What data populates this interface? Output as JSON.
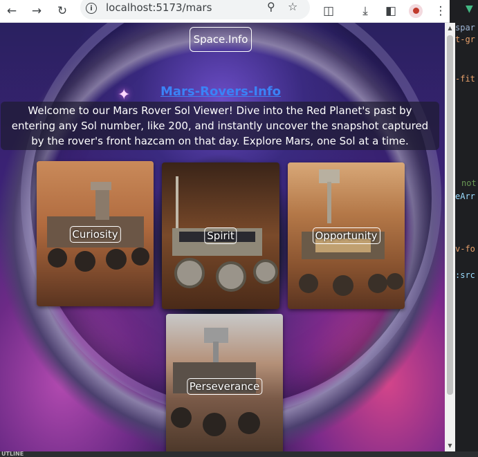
{
  "browser": {
    "url": "localhost:5173/mars",
    "icons": {
      "back": "arrow-left-icon",
      "forward": "arrow-right-icon",
      "reload": "reload-icon",
      "site_info": "info-icon",
      "zoom": "zoom-icon",
      "bookmark": "star-icon",
      "extensions": "puzzle-icon",
      "download": "download-icon",
      "sidepanel": "side-panel-icon",
      "menu": "kebab-menu-icon"
    }
  },
  "header": {
    "brand": "Space.Info"
  },
  "main": {
    "title": "Mars-Rovers-Info",
    "intro": "Welcome to our Mars Rover Sol Viewer! Dive into the Red Planet's past by entering any Sol number, like 200, and instantly uncover the snapshot captured by the rover's front hazcam on that day. Explore Mars, one Sol at a time.",
    "rovers": [
      {
        "name": "Curiosity"
      },
      {
        "name": "Spirit"
      },
      {
        "name": "Opportunity"
      },
      {
        "name": "Perseverance"
      }
    ]
  },
  "editor": {
    "lines": [
      "spar",
      "t-gr",
      "-fit",
      "not",
      "eArr",
      "v-fo",
      ":src"
    ]
  },
  "status": {
    "outline_label": "UTLINE"
  },
  "colors": {
    "title_link": "#3b82f6",
    "scrollbar_track": "#f1f1f1",
    "editor_bg": "#1e1f22",
    "vue_green": "#42b883"
  }
}
